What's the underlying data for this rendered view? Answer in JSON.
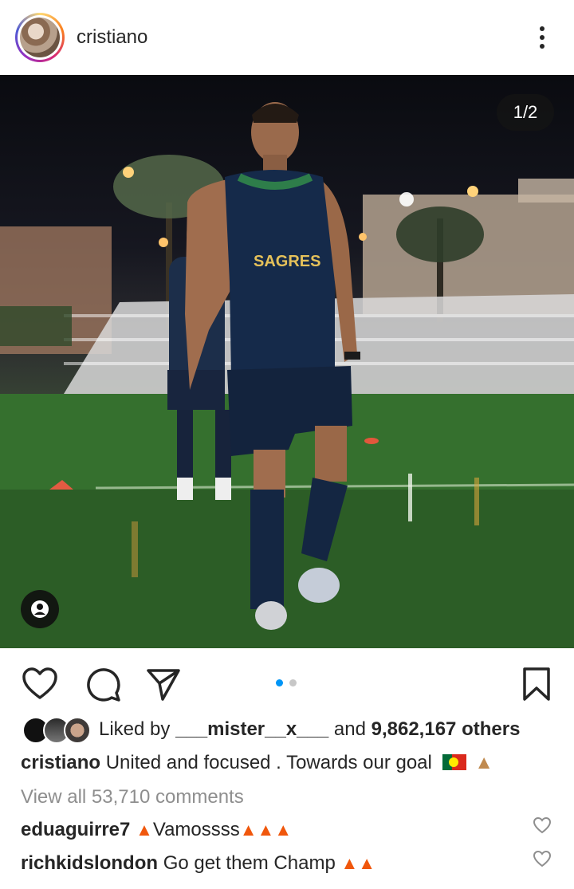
{
  "post": {
    "username": "cristiano",
    "counter": "1/2"
  },
  "likes": {
    "prefix": "Liked by",
    "liker": "___mister__x___",
    "middle": "and",
    "count": "9,862,167 others"
  },
  "caption": {
    "username": "cristiano",
    "text": "United and focused . Towards our goal"
  },
  "view_all": "View all 53,710 comments",
  "comments": [
    {
      "username": "eduaguirre7",
      "text": "Vamossss",
      "fires_before": 1,
      "fires_after": 3
    },
    {
      "username": "richkidslondon",
      "text": "Go get them Champ",
      "fires_before": 0,
      "fires_after": 2
    }
  ],
  "icons": {
    "more": "more-options-icon",
    "like": "heart-icon",
    "comment": "comment-icon",
    "share": "send-icon",
    "save": "bookmark-icon",
    "tag": "user-tag-icon"
  },
  "carousel": {
    "total": 2,
    "active": 1
  },
  "colors": {
    "text": "#262626",
    "muted": "#8e8e8e",
    "active_dot": "#0095f6",
    "inactive_dot": "#c7c7c7"
  }
}
